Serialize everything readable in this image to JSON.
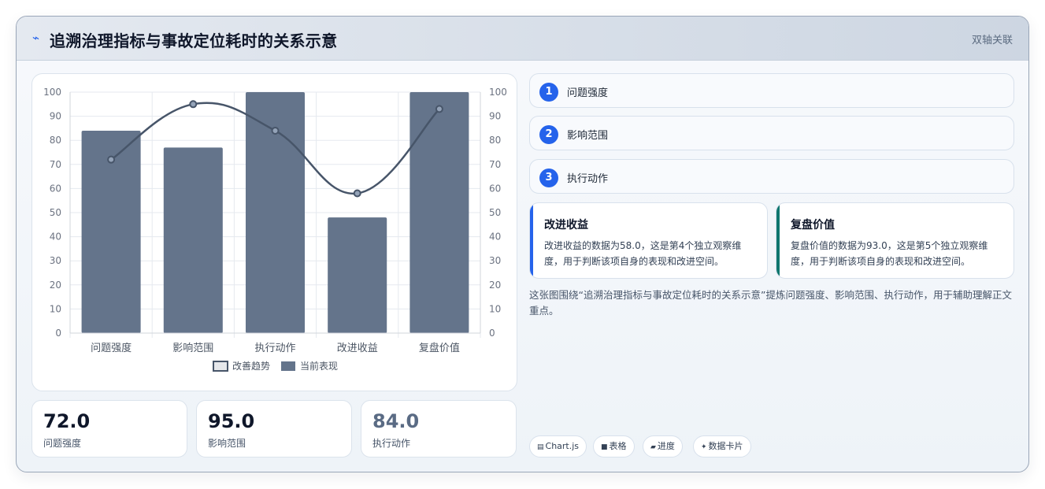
{
  "header": {
    "icon": "lightning-icon",
    "title": "追溯治理指标与事故定位耗时的关系示意",
    "tag": "双轴关联"
  },
  "chart_data": {
    "type": "bar",
    "categories": [
      "问题强度",
      "影响范围",
      "执行动作",
      "改进收益",
      "复盘价值"
    ],
    "series": [
      {
        "name": "当前表现",
        "type": "bar",
        "color": "#64748b",
        "values": [
          84,
          77,
          100,
          48,
          100
        ]
      },
      {
        "name": "改善趋势",
        "type": "line",
        "color": "#475569",
        "values": [
          72,
          95,
          84,
          58,
          93
        ]
      }
    ],
    "y_left": {
      "min": 0,
      "max": 100,
      "ticks": [
        0,
        10,
        20,
        30,
        40,
        50,
        60,
        70,
        80,
        90,
        100
      ]
    },
    "y_right": {
      "min": 0,
      "max": 100,
      "ticks": [
        0,
        10,
        20,
        30,
        40,
        50,
        60,
        70,
        80,
        90,
        100
      ]
    },
    "grid": true,
    "legend_position": "bottom",
    "legend": [
      "改善趋势",
      "当前表现"
    ]
  },
  "stats": [
    {
      "value": "72.0",
      "label": "问题强度"
    },
    {
      "value": "95.0",
      "label": "影响范围"
    },
    {
      "value": "84.0",
      "label": "执行动作"
    }
  ],
  "steps": [
    {
      "num": "1",
      "label": "问题强度"
    },
    {
      "num": "2",
      "label": "影响范围"
    },
    {
      "num": "3",
      "label": "执行动作"
    }
  ],
  "info_cards": [
    {
      "title": "改进收益",
      "accent": "#2563eb",
      "text": "改进收益的数据为58.0，这是第4个独立观察维度，用于判断该项自身的表现和改进空间。"
    },
    {
      "title": "复盘价值",
      "accent": "#0f766e",
      "text": "复盘价值的数据为93.0，这是第5个独立观察维度，用于判断该项自身的表现和改进空间。"
    }
  ],
  "summary": "这张图围绕“追溯治理指标与事故定位耗时的关系示意”提炼问题强度、影响范围、执行动作，用于辅助理解正文重点。",
  "chips": [
    {
      "icon": "▤",
      "label": "Chart.js"
    },
    {
      "icon": "■",
      "label": "表格"
    },
    {
      "icon": "▰",
      "label": "进度"
    },
    {
      "icon": "✦",
      "label": "数据卡片"
    }
  ]
}
